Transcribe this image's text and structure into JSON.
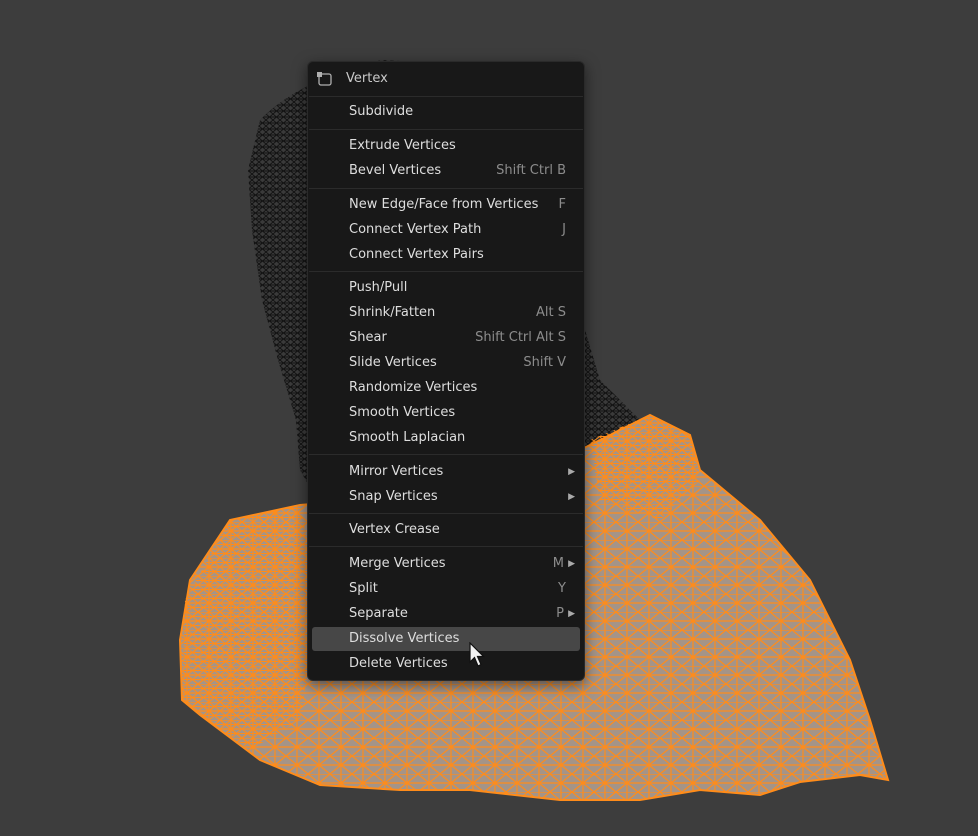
{
  "menu": {
    "title": "Vertex",
    "icon": "vertex-select-icon",
    "items": [
      {
        "label": "Subdivide",
        "shortcut": ""
      },
      {
        "label": "Extrude Vertices",
        "shortcut": ""
      },
      {
        "label": "Bevel Vertices",
        "shortcut": "Shift Ctrl B"
      },
      {
        "label": "New Edge/Face from Vertices",
        "shortcut": "F"
      },
      {
        "label": "Connect Vertex Path",
        "shortcut": "J"
      },
      {
        "label": "Connect Vertex Pairs",
        "shortcut": ""
      },
      {
        "label": "Push/Pull",
        "shortcut": ""
      },
      {
        "label": "Shrink/Fatten",
        "shortcut": "Alt S"
      },
      {
        "label": "Shear",
        "shortcut": "Shift Ctrl Alt S"
      },
      {
        "label": "Slide Vertices",
        "shortcut": "Shift V"
      },
      {
        "label": "Randomize Vertices",
        "shortcut": ""
      },
      {
        "label": "Smooth Vertices",
        "shortcut": ""
      },
      {
        "label": "Smooth Laplacian",
        "shortcut": ""
      },
      {
        "label": "Mirror Vertices",
        "shortcut": "",
        "submenu": true
      },
      {
        "label": "Snap Vertices",
        "shortcut": "",
        "submenu": true
      },
      {
        "label": "Vertex Crease",
        "shortcut": ""
      },
      {
        "label": "Merge Vertices",
        "shortcut": "M",
        "submenu": true
      },
      {
        "label": "Split",
        "shortcut": "Y"
      },
      {
        "label": "Separate",
        "shortcut": "P",
        "submenu": true
      },
      {
        "label": "Dissolve Vertices",
        "shortcut": "",
        "highlighted": true
      },
      {
        "label": "Delete Vertices",
        "shortcut": ""
      }
    ]
  },
  "viewport": {
    "background": "#3d3d3d",
    "mesh_color": "#ff8c1a",
    "surface_color": "#a49488",
    "unselected_wire_color": "#111111"
  }
}
